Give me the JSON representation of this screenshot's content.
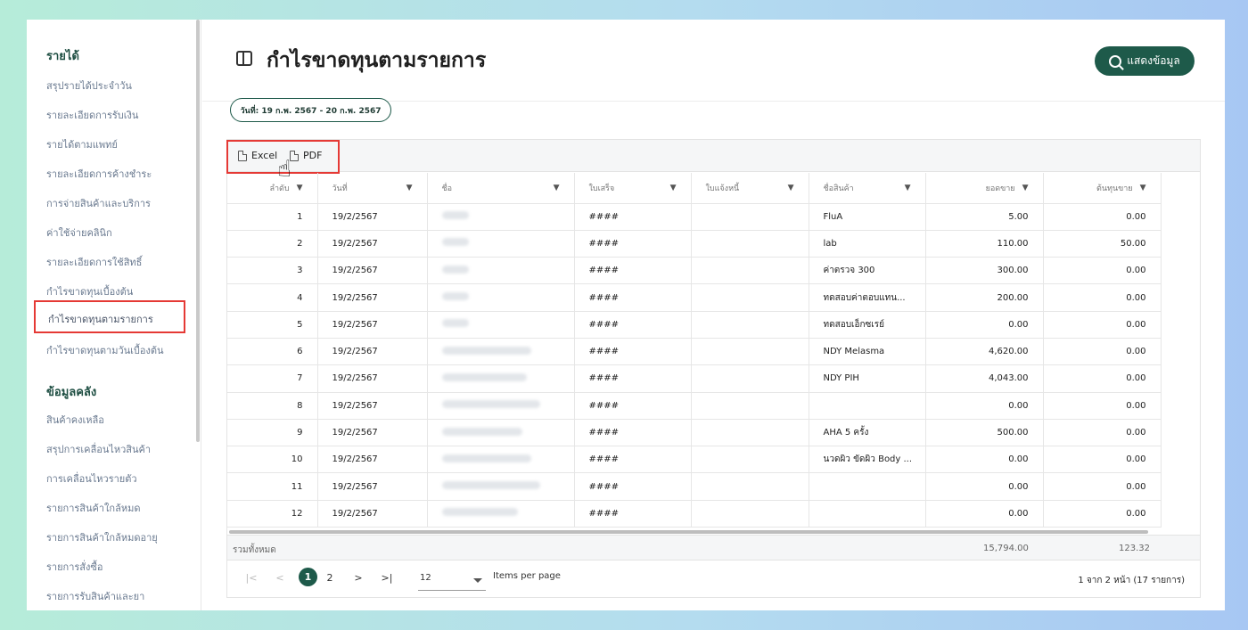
{
  "sidebar": {
    "section_income": "รายได้",
    "income_items": [
      "สรุปรายได้ประจำวัน",
      "รายละเอียดการรับเงิน",
      "รายได้ตามแพทย์",
      "รายละเอียดการค้างชำระ",
      "การจ่ายสินค้าและบริการ",
      "ค่าใช้จ่ายคลินิก",
      "รายละเอียดการใช้สิทธิ์",
      "กำไรขาดทุนเบื้องต้น",
      "กำไรขาดทุนตามรายการ",
      "กำไรขาดทุนตามวันเบื้องต้น"
    ],
    "section_inventory": "ข้อมูลคลัง",
    "inventory_items": [
      "สินค้าคงเหลือ",
      "สรุปการเคลื่อนไหวสินค้า",
      "การเคลื่อนไหวรายตัว",
      "รายการสินค้าใกล้หมด",
      "รายการสินค้าใกล้หมดอายุ",
      "รายการสั่งซื้อ",
      "รายการรับสินค้าและยา"
    ],
    "active_item": "กำไรขาดทุนตามรายการ"
  },
  "header": {
    "title": "กำไรขาดทุนตามรายการ",
    "show_button": "แสดงข้อมูล",
    "date_range": "วันที่: 19 ก.พ. 2567 - 20 ก.พ. 2567"
  },
  "toolbar": {
    "excel": "Excel",
    "pdf": "PDF"
  },
  "table": {
    "columns": [
      "ลำดับ",
      "วันที่",
      "ชื่อ",
      "ใบเสร็จ",
      "ใบแจ้งหนี้",
      "ชื่อสินค้า",
      "ยอดขาย",
      "ต้นทุนขาย"
    ],
    "rows": [
      {
        "no": "1",
        "date": "19/2/2567",
        "receipt": "####",
        "invoice": "",
        "product": "FluA",
        "sales": "5.00",
        "cost": "0.00"
      },
      {
        "no": "2",
        "date": "19/2/2567",
        "receipt": "####",
        "invoice": "",
        "product": "lab",
        "sales": "110.00",
        "cost": "50.00"
      },
      {
        "no": "3",
        "date": "19/2/2567",
        "receipt": "####",
        "invoice": "",
        "product": "ค่าตรวจ 300",
        "sales": "300.00",
        "cost": "0.00"
      },
      {
        "no": "4",
        "date": "19/2/2567",
        "receipt": "####",
        "invoice": "",
        "product": "ทดสอบค่าตอบแทน...",
        "sales": "200.00",
        "cost": "0.00"
      },
      {
        "no": "5",
        "date": "19/2/2567",
        "receipt": "####",
        "invoice": "",
        "product": "ทดสอบเอ็กซเรย์",
        "sales": "0.00",
        "cost": "0.00"
      },
      {
        "no": "6",
        "date": "19/2/2567",
        "receipt": "####",
        "invoice": "",
        "product": "NDY Melasma",
        "sales": "4,620.00",
        "cost": "0.00"
      },
      {
        "no": "7",
        "date": "19/2/2567",
        "receipt": "####",
        "invoice": "",
        "product": "NDY PIH",
        "sales": "4,043.00",
        "cost": "0.00"
      },
      {
        "no": "8",
        "date": "19/2/2567",
        "receipt": "####",
        "invoice": "",
        "product": "",
        "sales": "0.00",
        "cost": "0.00"
      },
      {
        "no": "9",
        "date": "19/2/2567",
        "receipt": "####",
        "invoice": "",
        "product": "AHA 5 ครั้ง",
        "sales": "500.00",
        "cost": "0.00"
      },
      {
        "no": "10",
        "date": "19/2/2567",
        "receipt": "####",
        "invoice": "",
        "product": "นวดผิว ขัดผิว Body ...",
        "sales": "0.00",
        "cost": "0.00"
      },
      {
        "no": "11",
        "date": "19/2/2567",
        "receipt": "####",
        "invoice": "",
        "product": "",
        "sales": "0.00",
        "cost": "0.00"
      },
      {
        "no": "12",
        "date": "19/2/2567",
        "receipt": "####",
        "invoice": "",
        "product": "",
        "sales": "0.00",
        "cost": "0.00"
      }
    ],
    "total_label": "รวมทั้งหมด",
    "total_sales": "15,794.00",
    "total_cost": "123.32"
  },
  "pagination": {
    "first": "|<",
    "prev": "<",
    "page1": "1",
    "page2": "2",
    "next": ">",
    "last": ">|",
    "per_page": "12",
    "per_page_label": "Items per page",
    "range": "1 จาก 2 หน้า (17 รายการ)"
  },
  "colors": {
    "accent": "#1e5a4a",
    "highlight": "#e53935"
  }
}
